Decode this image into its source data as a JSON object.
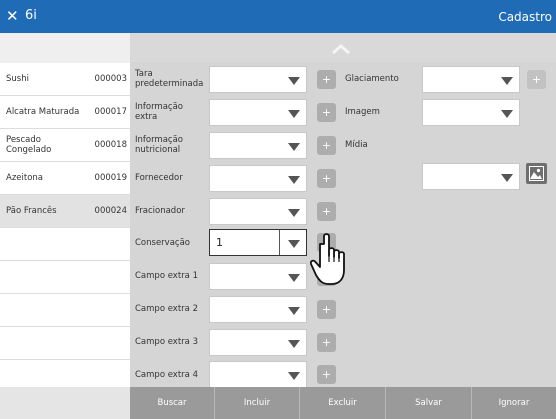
{
  "app": {
    "name": "6i",
    "title": "Cadastro"
  },
  "list": {
    "items": [
      {
        "name": "Sushi",
        "code": "000003",
        "selected": false
      },
      {
        "name": "Alcatra Maturada",
        "code": "000017",
        "selected": false
      },
      {
        "name": "Pescado Congelado",
        "code": "000018",
        "selected": false
      },
      {
        "name": "Azeitona",
        "code": "000019",
        "selected": false
      },
      {
        "name": "Pão Francês",
        "code": "000024",
        "selected": true
      }
    ]
  },
  "form": {
    "left_fields": [
      {
        "label": "Tara predeterminada",
        "value": ""
      },
      {
        "label": "Informação extra",
        "value": ""
      },
      {
        "label": "Informação nutricional",
        "value": ""
      },
      {
        "label": "Fornecedor",
        "value": ""
      },
      {
        "label": "Fracionador",
        "value": ""
      },
      {
        "label": "Conservação",
        "value": "1"
      },
      {
        "label": "Campo extra 1",
        "value": ""
      },
      {
        "label": "Campo extra 2",
        "value": ""
      },
      {
        "label": "Campo extra 3",
        "value": ""
      },
      {
        "label": "Campo extra 4",
        "value": ""
      }
    ],
    "right_fields": [
      {
        "label": "Glaciamento",
        "value": ""
      },
      {
        "label": "Imagem",
        "value": ""
      },
      {
        "label": "Mídia",
        "value": ""
      }
    ],
    "plus_symbol": "+"
  },
  "footer": {
    "buttons": [
      "Buscar",
      "Incluir",
      "Excluir",
      "Salvar",
      "Ignorar"
    ]
  },
  "colors": {
    "titlebar": "#1f6bb6",
    "plus_button": "#adadad",
    "footer": "#9a9a9a"
  },
  "icons": {
    "close": "close-icon",
    "collapse": "chevron-up-icon",
    "image": "image-icon",
    "dropdown": "caret-down-icon",
    "pointer": "hand-pointer-icon"
  }
}
